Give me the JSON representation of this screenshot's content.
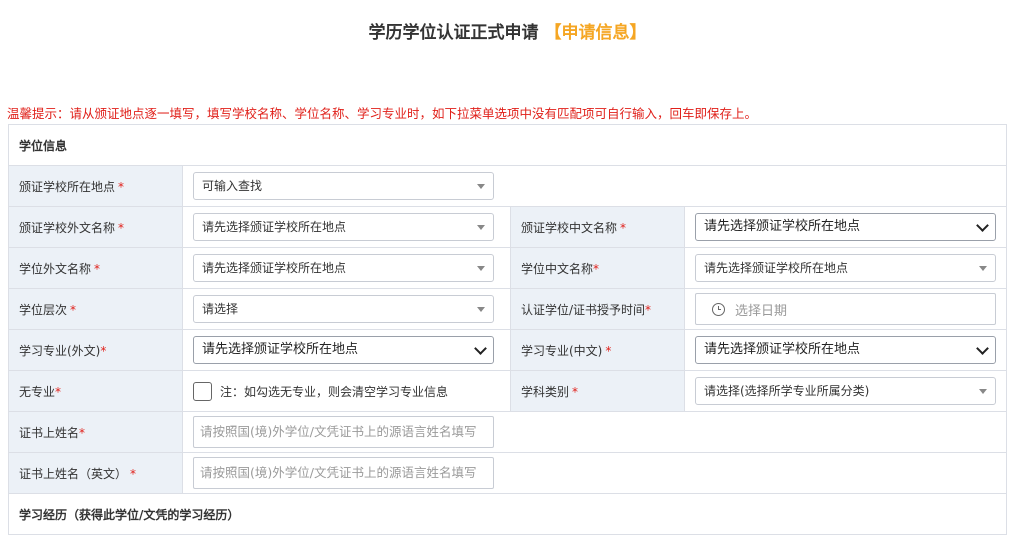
{
  "page": {
    "title": "学历学位认证正式申请",
    "title_highlight": "【申请信息】",
    "hint": "温馨提示：请从颁证地点逐一填写，填写学校名称、学位名称、学习专业时，如下拉菜单选项中没有匹配项可自行输入，回车即保存上。"
  },
  "colors": {
    "accent": "#f5a623",
    "required": "#e0201a",
    "label_bg": "#ecf1f7"
  },
  "sections": {
    "degree": "学位信息",
    "study": "学习经历（获得此学位/文凭的学习经历）"
  },
  "fields": {
    "issuing_location": {
      "label": "颁证学校所在地点",
      "required": "*",
      "value": "可输入查找"
    },
    "school_foreign_name": {
      "label": "颁证学校外文名称",
      "required": "*",
      "value": "请先选择颁证学校所在地点"
    },
    "school_chinese_name": {
      "label": "颁证学校中文名称",
      "required": "*",
      "value": "请先选择颁证学校所在地点"
    },
    "degree_foreign_name": {
      "label": "学位外文名称",
      "required": "*",
      "value": "请先选择颁证学校所在地点"
    },
    "degree_chinese_name": {
      "label": "学位中文名称",
      "required": "*",
      "value": "请先选择颁证学校所在地点"
    },
    "degree_level": {
      "label": "学位层次",
      "required": "*",
      "value": "请选择"
    },
    "award_date": {
      "label": "认证学位/证书授予时间",
      "required": "*",
      "placeholder": "选择日期",
      "icon": "clock-icon"
    },
    "major_foreign": {
      "label": "学习专业(外文)",
      "required": "*",
      "value": "请先选择颁证学校所在地点"
    },
    "major_chinese": {
      "label": "学习专业(中文)",
      "required": "*",
      "value": "请先选择颁证学校所在地点"
    },
    "no_major": {
      "label": "无专业",
      "required": "*",
      "note": "注：如勾选无专业，则会清空学习专业信息"
    },
    "subject_category": {
      "label": "学科类别",
      "required": "*",
      "value": "请选择(选择所学专业所属分类)"
    },
    "cert_name": {
      "label": "证书上姓名",
      "required": "*",
      "placeholder": "请按照国(境)外学位/文凭证书上的源语言姓名填写"
    },
    "cert_name_en": {
      "label": "证书上姓名（英文）",
      "required": "*",
      "placeholder": "请按照国(境)外学位/文凭证书上的源语言姓名填写"
    }
  }
}
